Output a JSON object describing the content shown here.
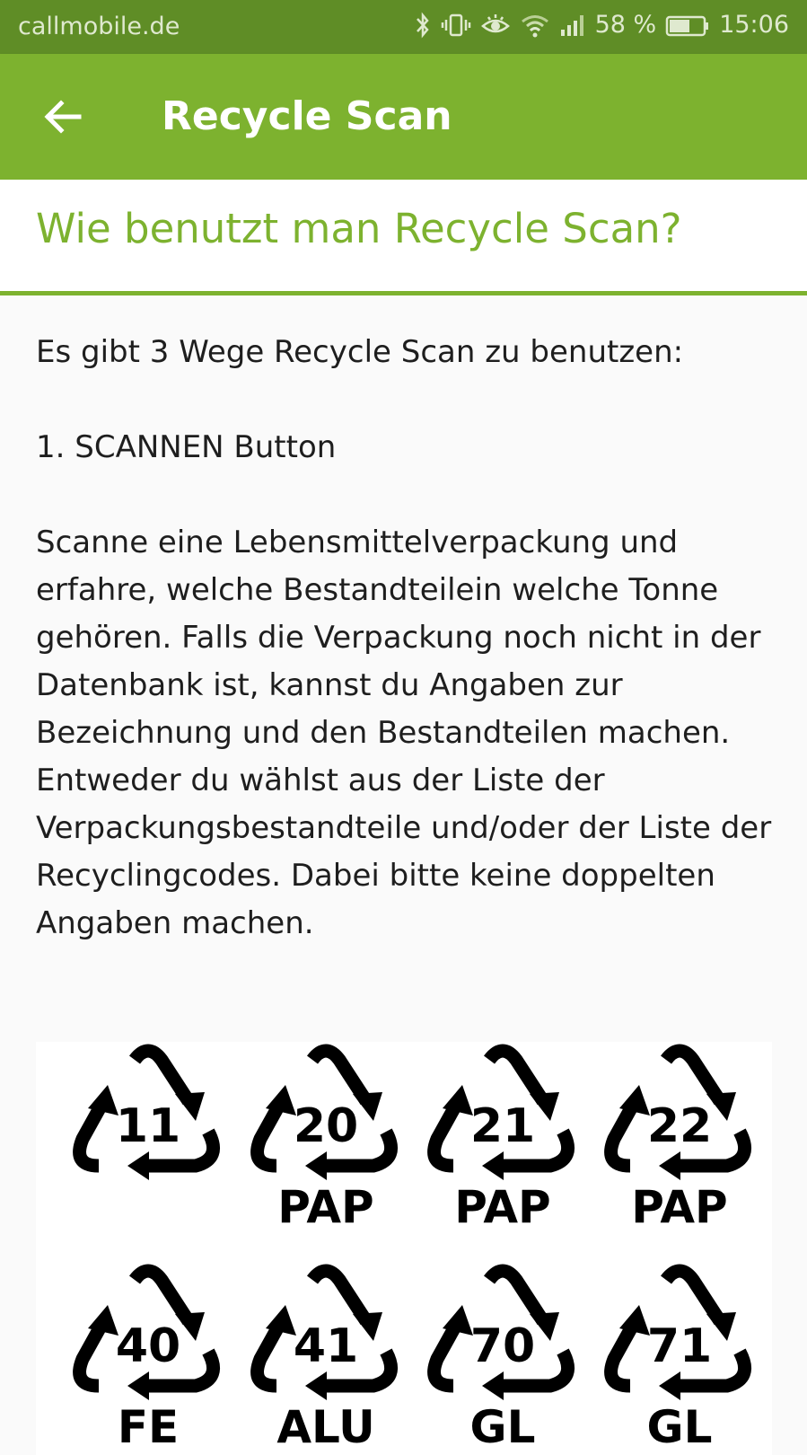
{
  "status_bar": {
    "carrier": "callmobile.de",
    "battery": "58 %",
    "time": "15:06",
    "icons": [
      "bluetooth-icon",
      "vibrate-icon",
      "eye-icon",
      "wifi-icon",
      "signal-icon",
      "battery-icon"
    ]
  },
  "app_bar": {
    "back_icon": "arrow-left-icon",
    "title": "Recycle Scan"
  },
  "page": {
    "heading": "Wie benutzt man Recycle Scan?",
    "intro": "Es gibt 3 Wege Recycle Scan zu benutzen:",
    "step1_title": "1. SCANNEN Button",
    "step1_body": "Scanne eine Lebensmittelverpackung und erfahre, welche Bestandteilein welche Tonne gehören. Falls die Verpackung noch nicht in der Datenbank ist, kannst du Angaben zur Bezeichnung und den Bestandteilen machen. Entweder du wählst aus der Liste der Verpackungsbestandteile und/oder der Liste der Recyclingcodes. Dabei bitte keine doppelten Angaben machen."
  },
  "recycling_codes": [
    {
      "number": "11",
      "material": ""
    },
    {
      "number": "20",
      "material": "PAP"
    },
    {
      "number": "21",
      "material": "PAP"
    },
    {
      "number": "22",
      "material": "PAP"
    },
    {
      "number": "40",
      "material": "FE"
    },
    {
      "number": "41",
      "material": "ALU"
    },
    {
      "number": "70",
      "material": "GL"
    },
    {
      "number": "71",
      "material": "GL"
    }
  ],
  "colors": {
    "status_bar": "#5f8d26",
    "app_bar": "#7db22f",
    "accent": "#7db22f"
  }
}
